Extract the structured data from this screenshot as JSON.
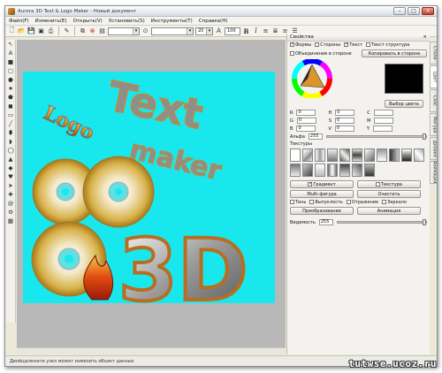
{
  "window": {
    "title": "Aurora 3D Text & Logo Maker - Новый документ"
  },
  "menu": [
    "Файл(F)",
    "Изменить(E)",
    "Открыть(V)",
    "Установить(S)",
    "Инструменты(T)",
    "Справка(H)"
  ],
  "toolbar": {
    "font_combo": "",
    "style_combo": "",
    "size_value": "20",
    "zoom_value": "100"
  },
  "panel": {
    "title": "Свойства",
    "top_checks": [
      "Формы",
      "Стороны",
      "Текст",
      "Текст структура"
    ],
    "obj_side_label": "Объединение в стороне",
    "copy_side_btn": "Копировать в стороне",
    "rgb_labels": [
      "R",
      "G",
      "B"
    ],
    "hsv_labels": [
      "H",
      "S",
      "V"
    ],
    "rgb_values": [
      "0",
      "0",
      "0"
    ],
    "hsv_values": [
      "0",
      "0",
      "0"
    ],
    "pick_color_btn": "Выбор цвета",
    "alpha_label": "Альфа",
    "alpha_value": "255",
    "textures_label": "Текстуры",
    "gradient_btn": "Градиент",
    "texture_btn": "Текстура",
    "multi_btn": "Multi-фигура",
    "clear_btn": "Очистить",
    "flags": [
      "Тень",
      "Выпуклость",
      "Отражение",
      "Зеркало"
    ],
    "transform_btn": "Преобразование",
    "animation_btn": "Анимация",
    "opacity_label": "Видимость",
    "opacity_value": "255"
  },
  "sidetabs": [
    "Стили",
    "Цвет",
    "Скос",
    "Фигура",
    "Дизайн",
    "Анимация"
  ],
  "status": {
    "text": "Двойщелкните узел может изменить объект данных"
  },
  "watermark": "tutwse.ucoz.ru",
  "canvas": {
    "art_text_1": "Logo",
    "art_text_2": "Text",
    "art_text_3": "maker",
    "art_text_4": "3D"
  },
  "colors": {
    "canvas_bg": "#18e8ee",
    "accent_gold": "#d9962c",
    "color_swatch": "#000000"
  }
}
